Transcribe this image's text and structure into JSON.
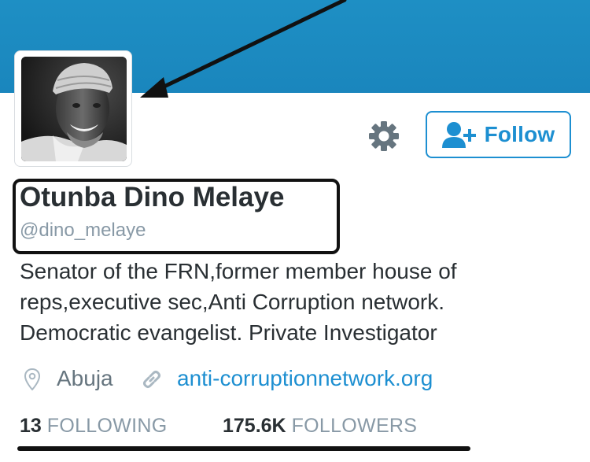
{
  "profile": {
    "display_name": "Otunba Dino Melaye",
    "handle": "@dino_melaye",
    "bio_lines": [
      "Senator of the FRN,former member house of",
      "reps,executive sec,Anti Corruption network.",
      "Democratic evangelist. Private Investigator"
    ],
    "location": "Abuja",
    "website": "anti-corruptionnetwork.org"
  },
  "actions": {
    "follow_label": "Follow"
  },
  "stats": {
    "following_count": "13",
    "following_label": "FOLLOWING",
    "followers_count": "175.6K",
    "followers_label": "FOLLOWERS"
  },
  "colors": {
    "header_blue": "#1a86bd",
    "accent_blue": "#1d8fd1",
    "text_dark": "#292f33",
    "text_muted": "#8899a6",
    "annotation_black": "#111111"
  },
  "icons": {
    "settings": "gear-icon",
    "follow": "add-user-icon",
    "location": "map-pin-icon",
    "website": "link-icon"
  }
}
